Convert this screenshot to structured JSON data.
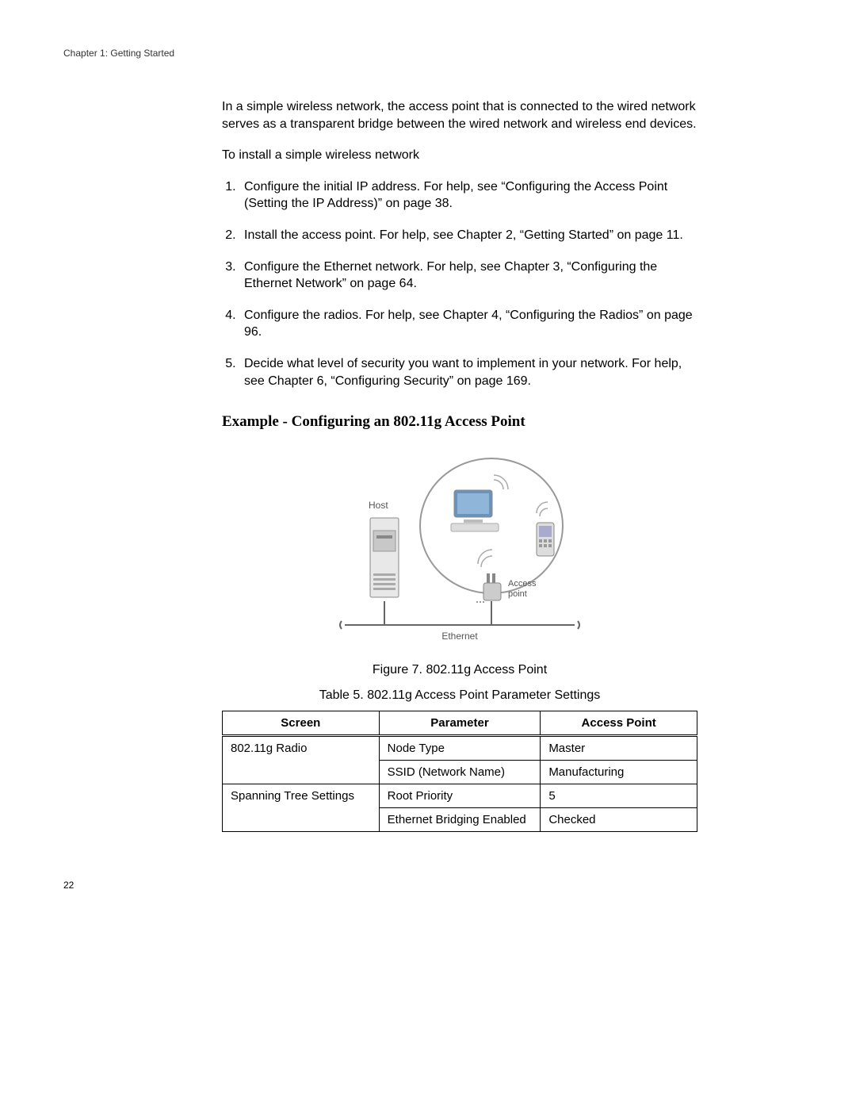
{
  "header": {
    "chapter": "Chapter 1: Getting Started"
  },
  "body": {
    "intro": "In a simple wireless network, the access point that is connected to the wired network serves as a transparent bridge between the wired network and wireless end devices.",
    "lead": "To install a simple wireless network",
    "steps": [
      "Configure the initial IP address. For help, see “Configuring the Access Point (Setting the IP Address)” on page 38.",
      "Install the access point. For help, see Chapter 2, “Getting Started” on page 11.",
      "Configure the Ethernet network. For help, see Chapter 3, “Configuring the Ethernet Network” on page 64.",
      "Configure the radios. For help, see Chapter 4, “Configuring the Radios” on page 96.",
      "Decide what level of security you want to implement in your network. For help, see Chapter 6, “Configuring Security” on page 169."
    ],
    "section_heading": "Example - Configuring an 802.11g Access Point",
    "figure": {
      "host_label": "Host",
      "ap_label": "Access\npoint",
      "bus_label": "Ethernet",
      "caption": "Figure 7. 802.11g Access Point"
    },
    "table": {
      "caption": "Table 5. 802.11g Access Point Parameter Settings",
      "headers": {
        "c1": "Screen",
        "c2": "Parameter",
        "c3": "Access Point"
      },
      "rows": [
        {
          "screen": "802.11g Radio",
          "screen_rowspan": 2,
          "param": "Node Type",
          "value": "Master"
        },
        {
          "param": "SSID (Network Name)",
          "value": "Manufacturing"
        },
        {
          "screen": "Spanning Tree Settings",
          "screen_rowspan": 2,
          "param": "Root Priority",
          "value": "5"
        },
        {
          "param": "Ethernet Bridging Enabled",
          "value": "Checked"
        }
      ]
    }
  },
  "footer": {
    "page": "22"
  }
}
